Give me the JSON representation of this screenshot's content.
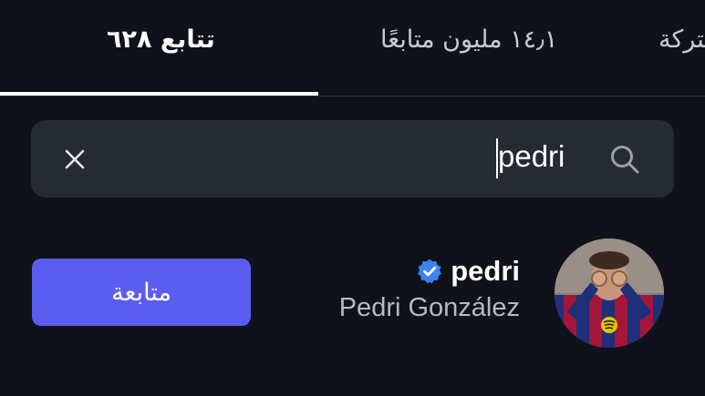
{
  "tabs": {
    "following_label": "تتابع ٦٢٨",
    "followers_label": "١٤٫١ مليون متابعًا",
    "mutual_label": "مشتركة"
  },
  "search": {
    "value": "pedri"
  },
  "result": {
    "username": "pedri",
    "full_name": "Pedri González",
    "verified": true,
    "follow_label": "متابعة"
  },
  "colors": {
    "background": "#0f121a",
    "search_bg": "#262a33",
    "follow_button": "#5b5cf0",
    "verified_badge": "#3b82f6"
  },
  "icons": [
    "clear-icon",
    "search-icon",
    "verified-badge-icon"
  ]
}
